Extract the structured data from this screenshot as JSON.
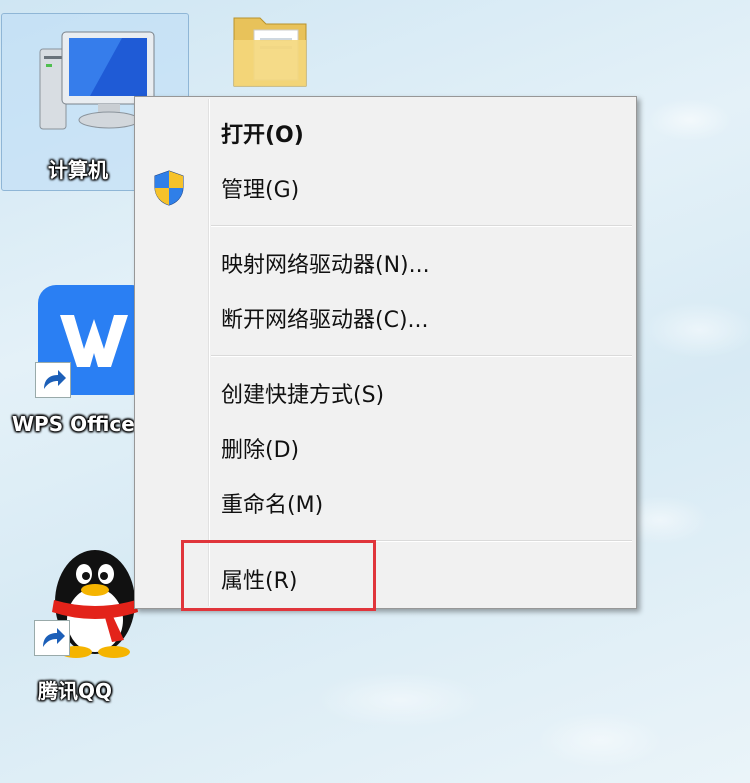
{
  "desktop": {
    "icons": [
      {
        "label": "计算机"
      },
      {
        "label": "WPS Office"
      },
      {
        "label": "腾讯QQ"
      }
    ]
  },
  "context_menu": {
    "items": [
      {
        "label": "打开(O)",
        "default": true
      },
      {
        "label": "管理(G)",
        "icon": "uac-shield-icon"
      },
      {
        "label": "映射网络驱动器(N)..."
      },
      {
        "label": "断开网络驱动器(C)..."
      },
      {
        "label": "创建快捷方式(S)"
      },
      {
        "label": "删除(D)"
      },
      {
        "label": "重命名(M)"
      },
      {
        "label": "属性(R)",
        "highlighted": true
      }
    ]
  },
  "colors": {
    "highlight_border": "#e0353b",
    "wps_blue": "#2a7ff3"
  }
}
